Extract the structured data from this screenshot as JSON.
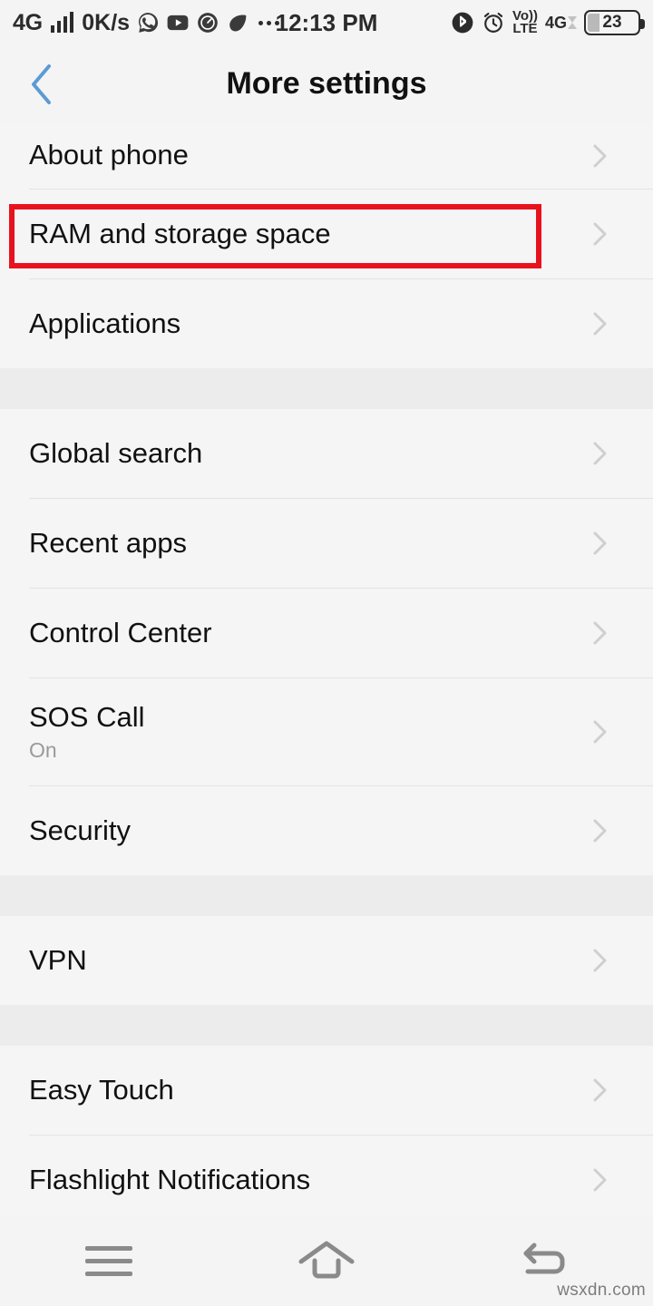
{
  "status_bar": {
    "network_type": "4G",
    "data_speed": "0K/s",
    "notification_icons": [
      "whatsapp-icon",
      "youtube-icon",
      "speedometer-icon",
      "app-icon"
    ],
    "overflow_indicator": "…",
    "clock": "12:13 PM",
    "right_icons": [
      "bluetooth-icon",
      "alarm-icon"
    ],
    "volte_top": "Vo))",
    "volte_bottom": "LTE",
    "signal_network": "4G",
    "battery_percent": "23"
  },
  "header": {
    "title": "More settings",
    "back_icon": "back-chevron-icon"
  },
  "highlight": {
    "color": "#e8121f",
    "target": "RAM and storage space"
  },
  "list": {
    "groups": [
      {
        "id": "device-group",
        "items": [
          {
            "label": "About phone",
            "sub": "",
            "clipped": true,
            "highlighted": false
          },
          {
            "label": "RAM and storage space",
            "sub": "",
            "clipped": false,
            "highlighted": true
          },
          {
            "label": "Applications",
            "sub": "",
            "clipped": false,
            "highlighted": false
          }
        ]
      },
      {
        "id": "system-group",
        "items": [
          {
            "label": "Global search",
            "sub": "",
            "clipped": false,
            "highlighted": false
          },
          {
            "label": "Recent apps",
            "sub": "",
            "clipped": false,
            "highlighted": false
          },
          {
            "label": "Control Center",
            "sub": "",
            "clipped": false,
            "highlighted": false
          },
          {
            "label": "SOS Call",
            "sub": "On",
            "clipped": false,
            "highlighted": false
          },
          {
            "label": "Security",
            "sub": "",
            "clipped": false,
            "highlighted": false
          }
        ]
      },
      {
        "id": "vpn-group",
        "items": [
          {
            "label": "VPN",
            "sub": "",
            "clipped": false,
            "highlighted": false
          }
        ]
      },
      {
        "id": "tools-group",
        "items": [
          {
            "label": "Easy Touch",
            "sub": "",
            "clipped": false,
            "highlighted": false
          },
          {
            "label": "Flashlight Notifications",
            "sub": "",
            "clipped": false,
            "highlighted": false
          }
        ]
      }
    ]
  },
  "nav_bar": {
    "menu_icon": "menu-icon",
    "home_icon": "home-icon",
    "back_icon": "back-arrow-icon"
  },
  "watermark": "wsxdn.com"
}
